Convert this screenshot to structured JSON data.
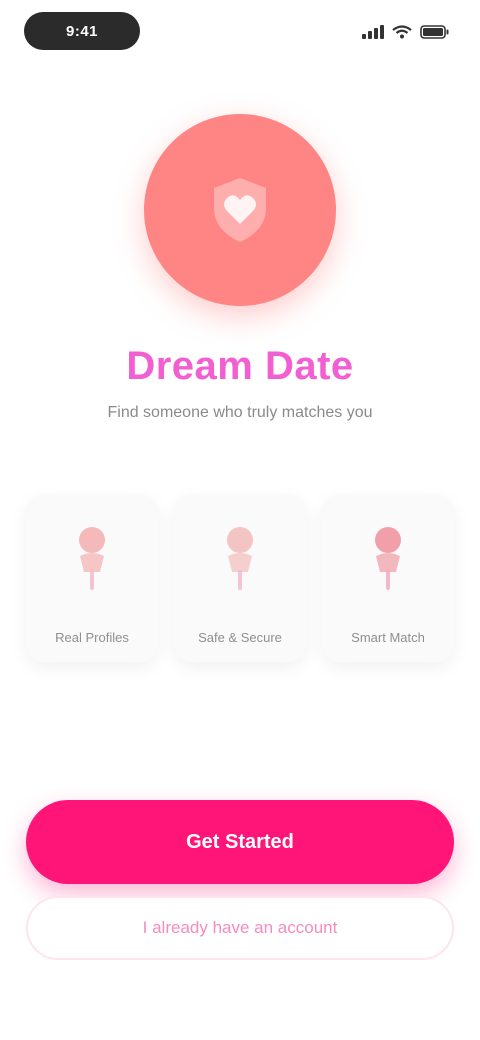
{
  "status_bar": {
    "time": "9:41",
    "signal_icon": "signal-bars-icon",
    "wifi_icon": "wifi-icon",
    "battery_icon": "battery-icon"
  },
  "hero": {
    "icon": "heart-shield-icon",
    "color": "#ff8585",
    "title": "Dream Date",
    "subtitle": "Find someone who truly matches you"
  },
  "features": [
    {
      "icon": "person-pin-icon",
      "label": "Real Profiles",
      "color": "#f4a3a3"
    },
    {
      "icon": "person-pin-icon",
      "label": "Safe & Secure",
      "color": "#f2b0b0"
    },
    {
      "icon": "person-pin-icon",
      "label": "Smart Match",
      "color": "#ef8a96"
    }
  ],
  "actions": {
    "primary_label": "Get Started",
    "secondary_label": "I already have an account"
  },
  "colors": {
    "accent": "#ff1578",
    "title": "#f25fd2",
    "subtitle": "#8a8a8a",
    "secondary_text": "#f48cbf"
  }
}
